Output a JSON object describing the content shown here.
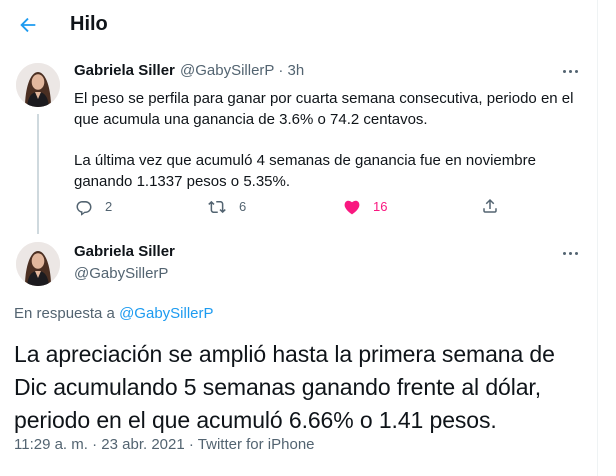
{
  "header": {
    "title": "Hilo"
  },
  "tweets": [
    {
      "name": "Gabriela Siller",
      "handle": "@GabySillerP",
      "separator": "·",
      "time": "3h",
      "paragraphs": [
        "El peso se perfila para ganar por cuarta semana consecutiva, periodo en el que acumula una ganancia de 3.6% o 74.2 centavos.",
        "La última vez que acumuló 4 semanas de ganancia fue en noviembre ganando 1.1337 pesos o 5.35%."
      ],
      "replies": "2",
      "retweets": "6",
      "likes": "16"
    },
    {
      "name": "Gabriela Siller",
      "handle": "@GabySillerP",
      "reply_prefix": "En respuesta a",
      "reply_handle": "@GabySillerP",
      "text": "La apreciación se amplió hasta la primera semana de Dic acumulando 5 semanas ganando frente al dólar, periodo en el que acumuló 6.66% o 1.41 pesos.",
      "time": "11:29 a. m.",
      "date": "23 abr. 2021",
      "source": "Twitter for iPhone",
      "separator": "·"
    }
  ],
  "icons": {
    "back": "arrow-left-icon",
    "more": "more-horizontal-icon",
    "reply": "reply-icon",
    "retweet": "retweet-icon",
    "like": "heart-icon",
    "share": "share-icon"
  },
  "colors": {
    "accent": "#1d9bf0",
    "like": "#f91880",
    "text": "#0f1419",
    "muted": "#536471",
    "thread_line": "#cfd9de"
  }
}
